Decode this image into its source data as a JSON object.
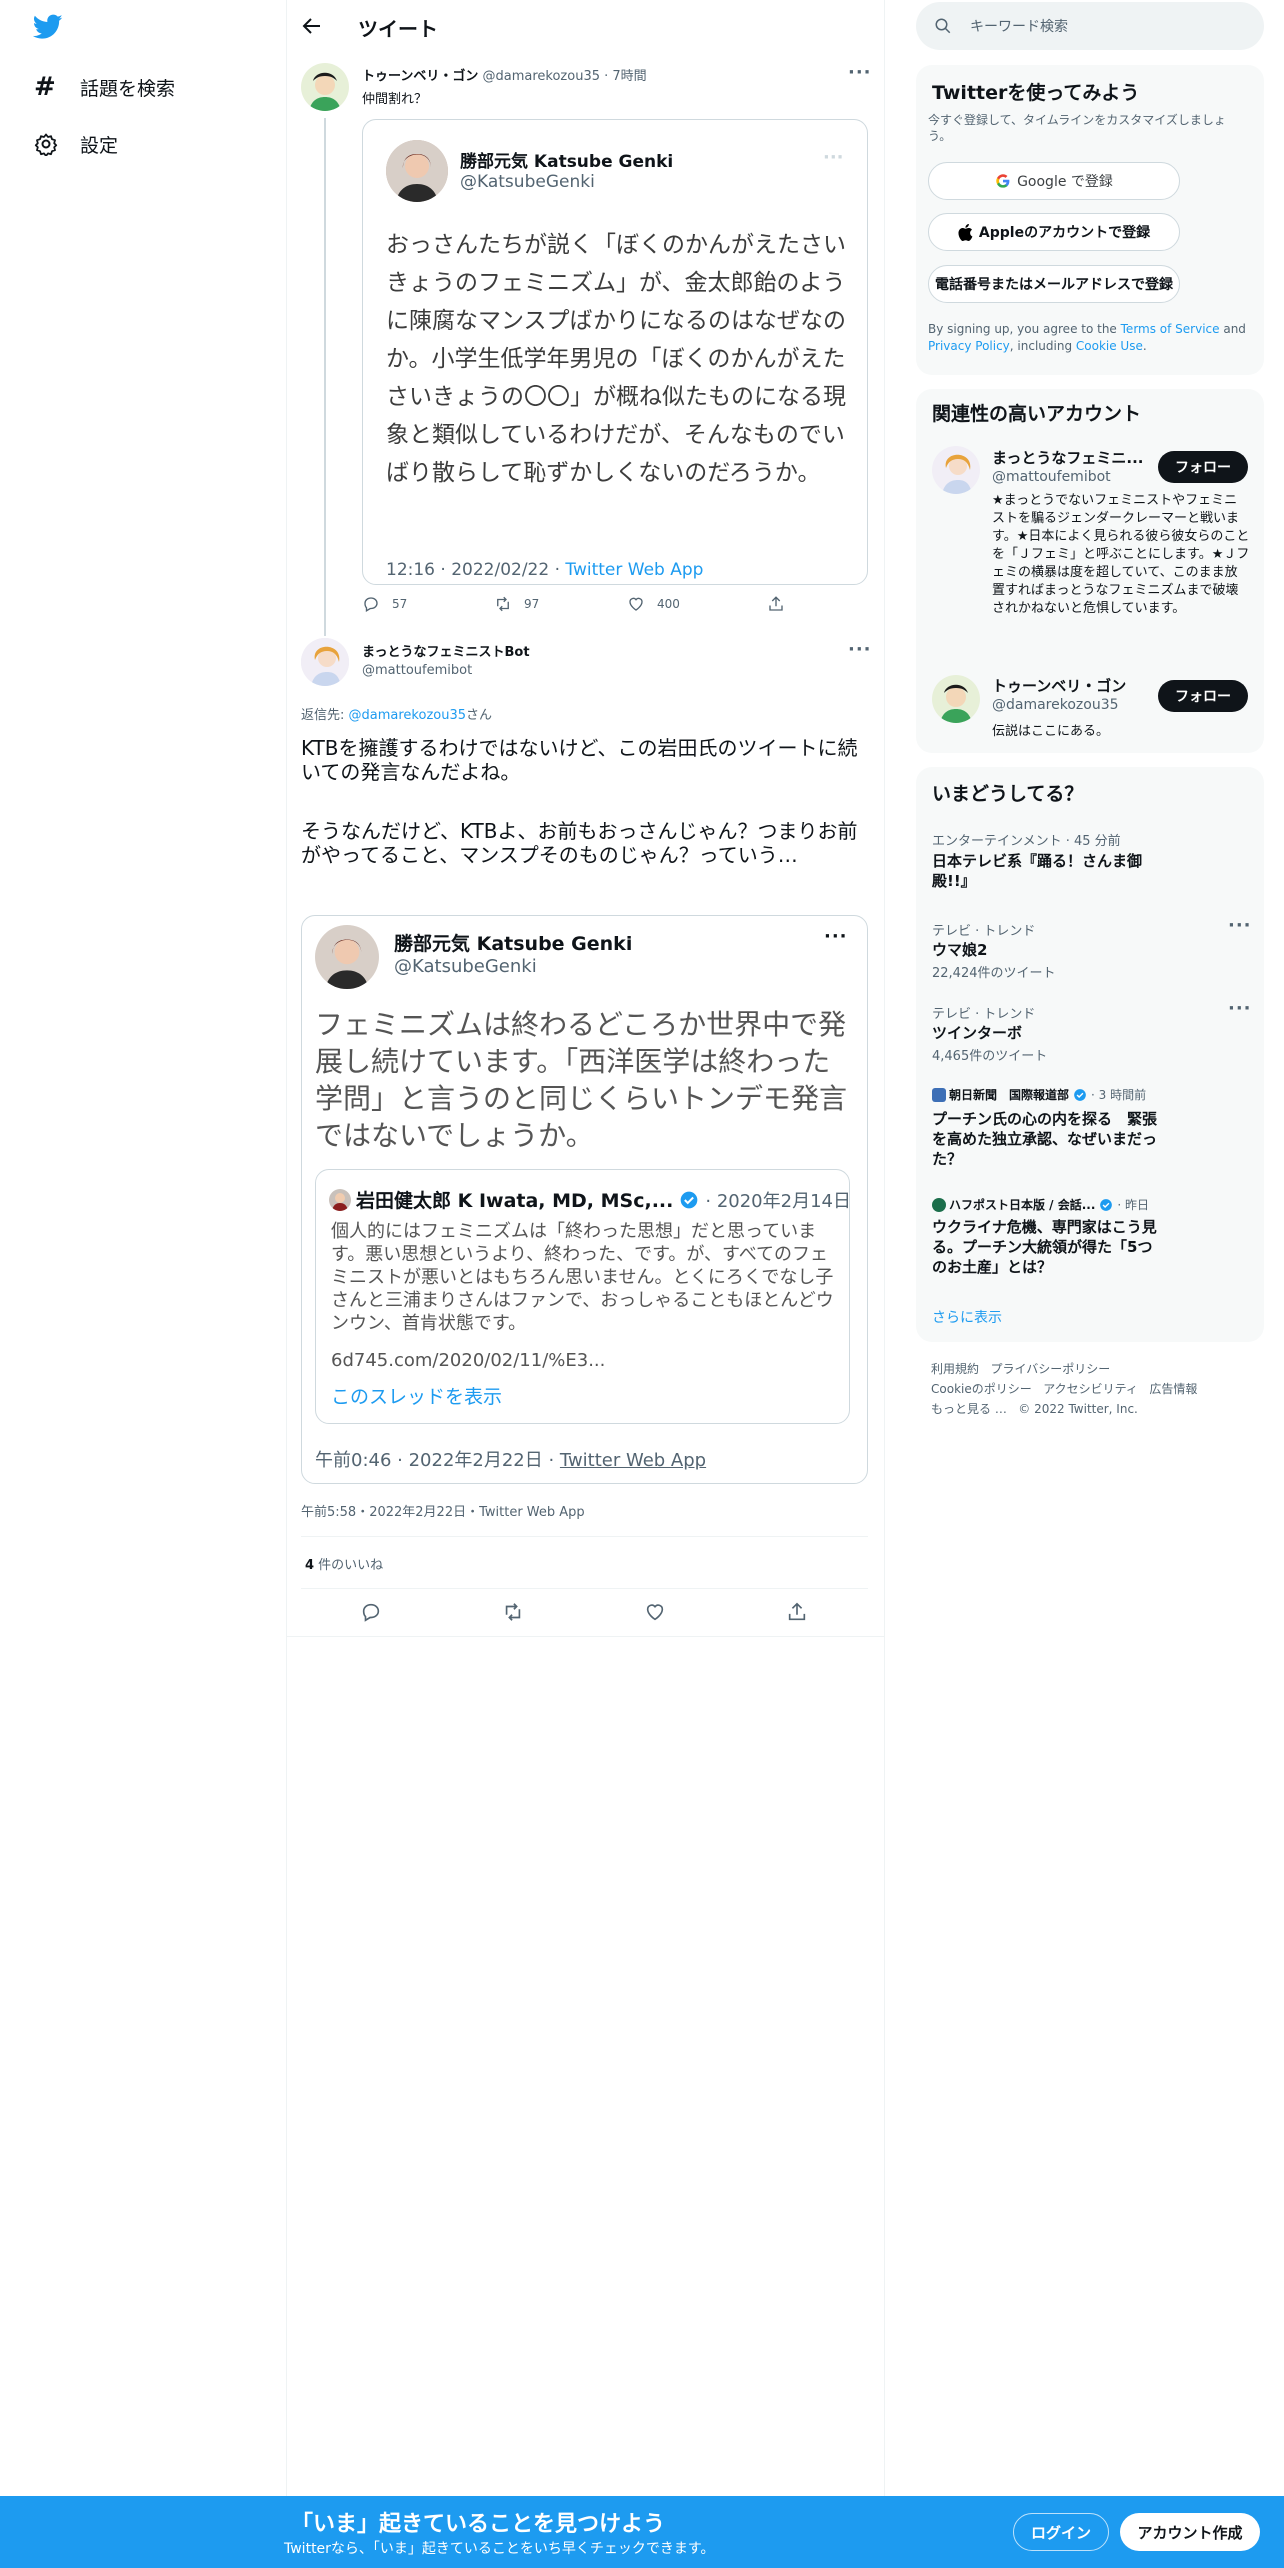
{
  "nav": {
    "explore": "話題を検索",
    "settings": "設定"
  },
  "header": {
    "title": "ツイート"
  },
  "search": {
    "placeholder": "キーワード検索"
  },
  "tweet1": {
    "name": "トゥーンベリ・ゴン",
    "handle": "@damarekozou35",
    "time": "· 7時間",
    "text": "仲間割れ？",
    "quote": {
      "name": "勝部元気 Katsube Genki",
      "handle": "@KatsubeGenki",
      "text": "おっさんたちが説く「ぼくのかんがえたさいきょうのフェミニズム」が、金太郎飴のように陳腐なマンスプばかりになるのはなぜなのか。小学生低学年男児の「ぼくのかんがえたさいきょうの〇〇」が概ね似たものになる現象と類似しているわけだが、そんなものでいばり散らして恥ずかしくないのだろうか。",
      "time": "12:16 · 2022/02/22 · ",
      "source": "Twitter Web App"
    },
    "replies": "57",
    "retweets": "97",
    "likes": "400"
  },
  "main_tweet": {
    "name": "まっとうなフェミニストBot",
    "handle": "@mattoufemibot",
    "reply_prefix": "返信先: ",
    "reply_to": "@damarekozou35",
    "reply_suffix": "さん",
    "text1": "KTBを擁護するわけではないけど、この岩田氏のツイートに続いての発言なんだよね。",
    "text2": "そうなんだけど、KTBよ、お前もおっさんじゃん？つまりお前がやってること、マンスプそのものじゃん？っていう…",
    "quote": {
      "name": "勝部元気 Katsube Genki",
      "handle": "@KatsubeGenki",
      "text": "フェミニズムは終わるどころか世界中で発展し続けています。「西洋医学は終わった学問」と言うのと同じくらいトンデモ発言ではないでしょうか。",
      "inner": {
        "name": "岩田健太郎 K Iwata, MD, MSc,...",
        "date": "· 2020年2月14日",
        "text": "個人的にはフェミニズムは「終わった思想」だと思っています。悪い思想というより、終わった、です。が、すべてのフェミニストが悪いとはもちろん思いません。とくにろくでなし子さんと三浦まりさんはファンで、おっしゃることもほとんどウンウン、首肯状態です。",
        "link": "6d745.com/2020/02/11/%E3...",
        "show_thread": "このスレッドを表示"
      },
      "time": "午前0:46 · 2022年2月22日 · ",
      "source": "Twitter Web App"
    },
    "timestamp": "午前5:58・2022年2月22日・Twitter Web App",
    "likes_count": "4",
    "likes_label": " 件のいいね"
  },
  "signup": {
    "title": "Twitterを使ってみよう",
    "subtitle": "今すぐ登録して、タイムラインをカスタマイズしましょう。",
    "google": "Google で登録",
    "apple": "Appleのアカウントで登録",
    "phone": "電話番号またはメールアドレスで登録",
    "legal_1": "By signing up, you agree to the ",
    "tos": "Terms of Service",
    "legal_2": " and ",
    "privacy": "Privacy Policy",
    "legal_3": ", including ",
    "cookie": "Cookie Use",
    "legal_4": "."
  },
  "relevant": {
    "title": "関連性の高いアカウント",
    "accounts": [
      {
        "name": "まっとうなフェミニ...",
        "handle": "@mattoufemibot",
        "follow": "フォロー",
        "bio": "★まっとうでないフェミニストやフェミニストを騙るジェンダークレーマーと戦います。★日本によく見られる彼ら彼女らのことを「Ｊフェミ」と呼ぶことにします。★Ｊフェミの横暴は度を超していて、このまま放置すればまっとうなフェミニズムまで破壊されかねないと危惧しています。"
      },
      {
        "name": "トゥーンベリ・ゴン",
        "handle": "@damarekozou35",
        "follow": "フォロー",
        "bio": "伝説はここにある。"
      }
    ]
  },
  "trends": {
    "title": "いまどうしてる？",
    "items": [
      {
        "category": "エンターテインメント · 45 分前",
        "name": "日本テレビ系『踊る！さんま御殿!!』"
      },
      {
        "category": "テレビ · トレンド",
        "name": "ウマ娘2",
        "count": "22,424件のツイート"
      },
      {
        "category": "テレビ · トレンド",
        "name": "ツインターボ",
        "count": "4,465件のツイート"
      },
      {
        "source": "朝日新聞　国際報道部",
        "time": "· 3 時間前",
        "name": "プーチン氏の心の内を探る　緊張を高めた独立承認、なぜいまだった？"
      },
      {
        "source": "ハフポスト日本版 / 会話...",
        "time": "· 昨日",
        "name": "ウクライナ危機、専門家はこう見る。プーチン大統領が得た「5つのお土産」とは？"
      }
    ],
    "show_more": "さらに表示"
  },
  "footer": {
    "links": [
      "利用規約",
      "プライバシーポリシー",
      "Cookieのポリシー",
      "アクセシビリティ",
      "広告情報",
      "もっと見る …",
      "© 2022 Twitter, Inc."
    ]
  },
  "banner": {
    "title": "「いま」起きていることを見つけよう",
    "subtitle": "Twitterなら、「いま」起きていることをいち早くチェックできます。",
    "login": "ログイン",
    "signup": "アカウント作成"
  },
  "colors": {
    "accent": "#1d9bf0",
    "banner": "#1d9bf0",
    "text": "#0f1419",
    "secondary": "#536471"
  },
  "icons": [
    "twitter-logo-icon",
    "hashtag-icon",
    "gear-icon",
    "back-arrow-icon",
    "search-icon",
    "reply-icon",
    "retweet-icon",
    "like-icon",
    "share-icon",
    "verified-icon",
    "more-icon",
    "google-icon",
    "apple-icon"
  ]
}
